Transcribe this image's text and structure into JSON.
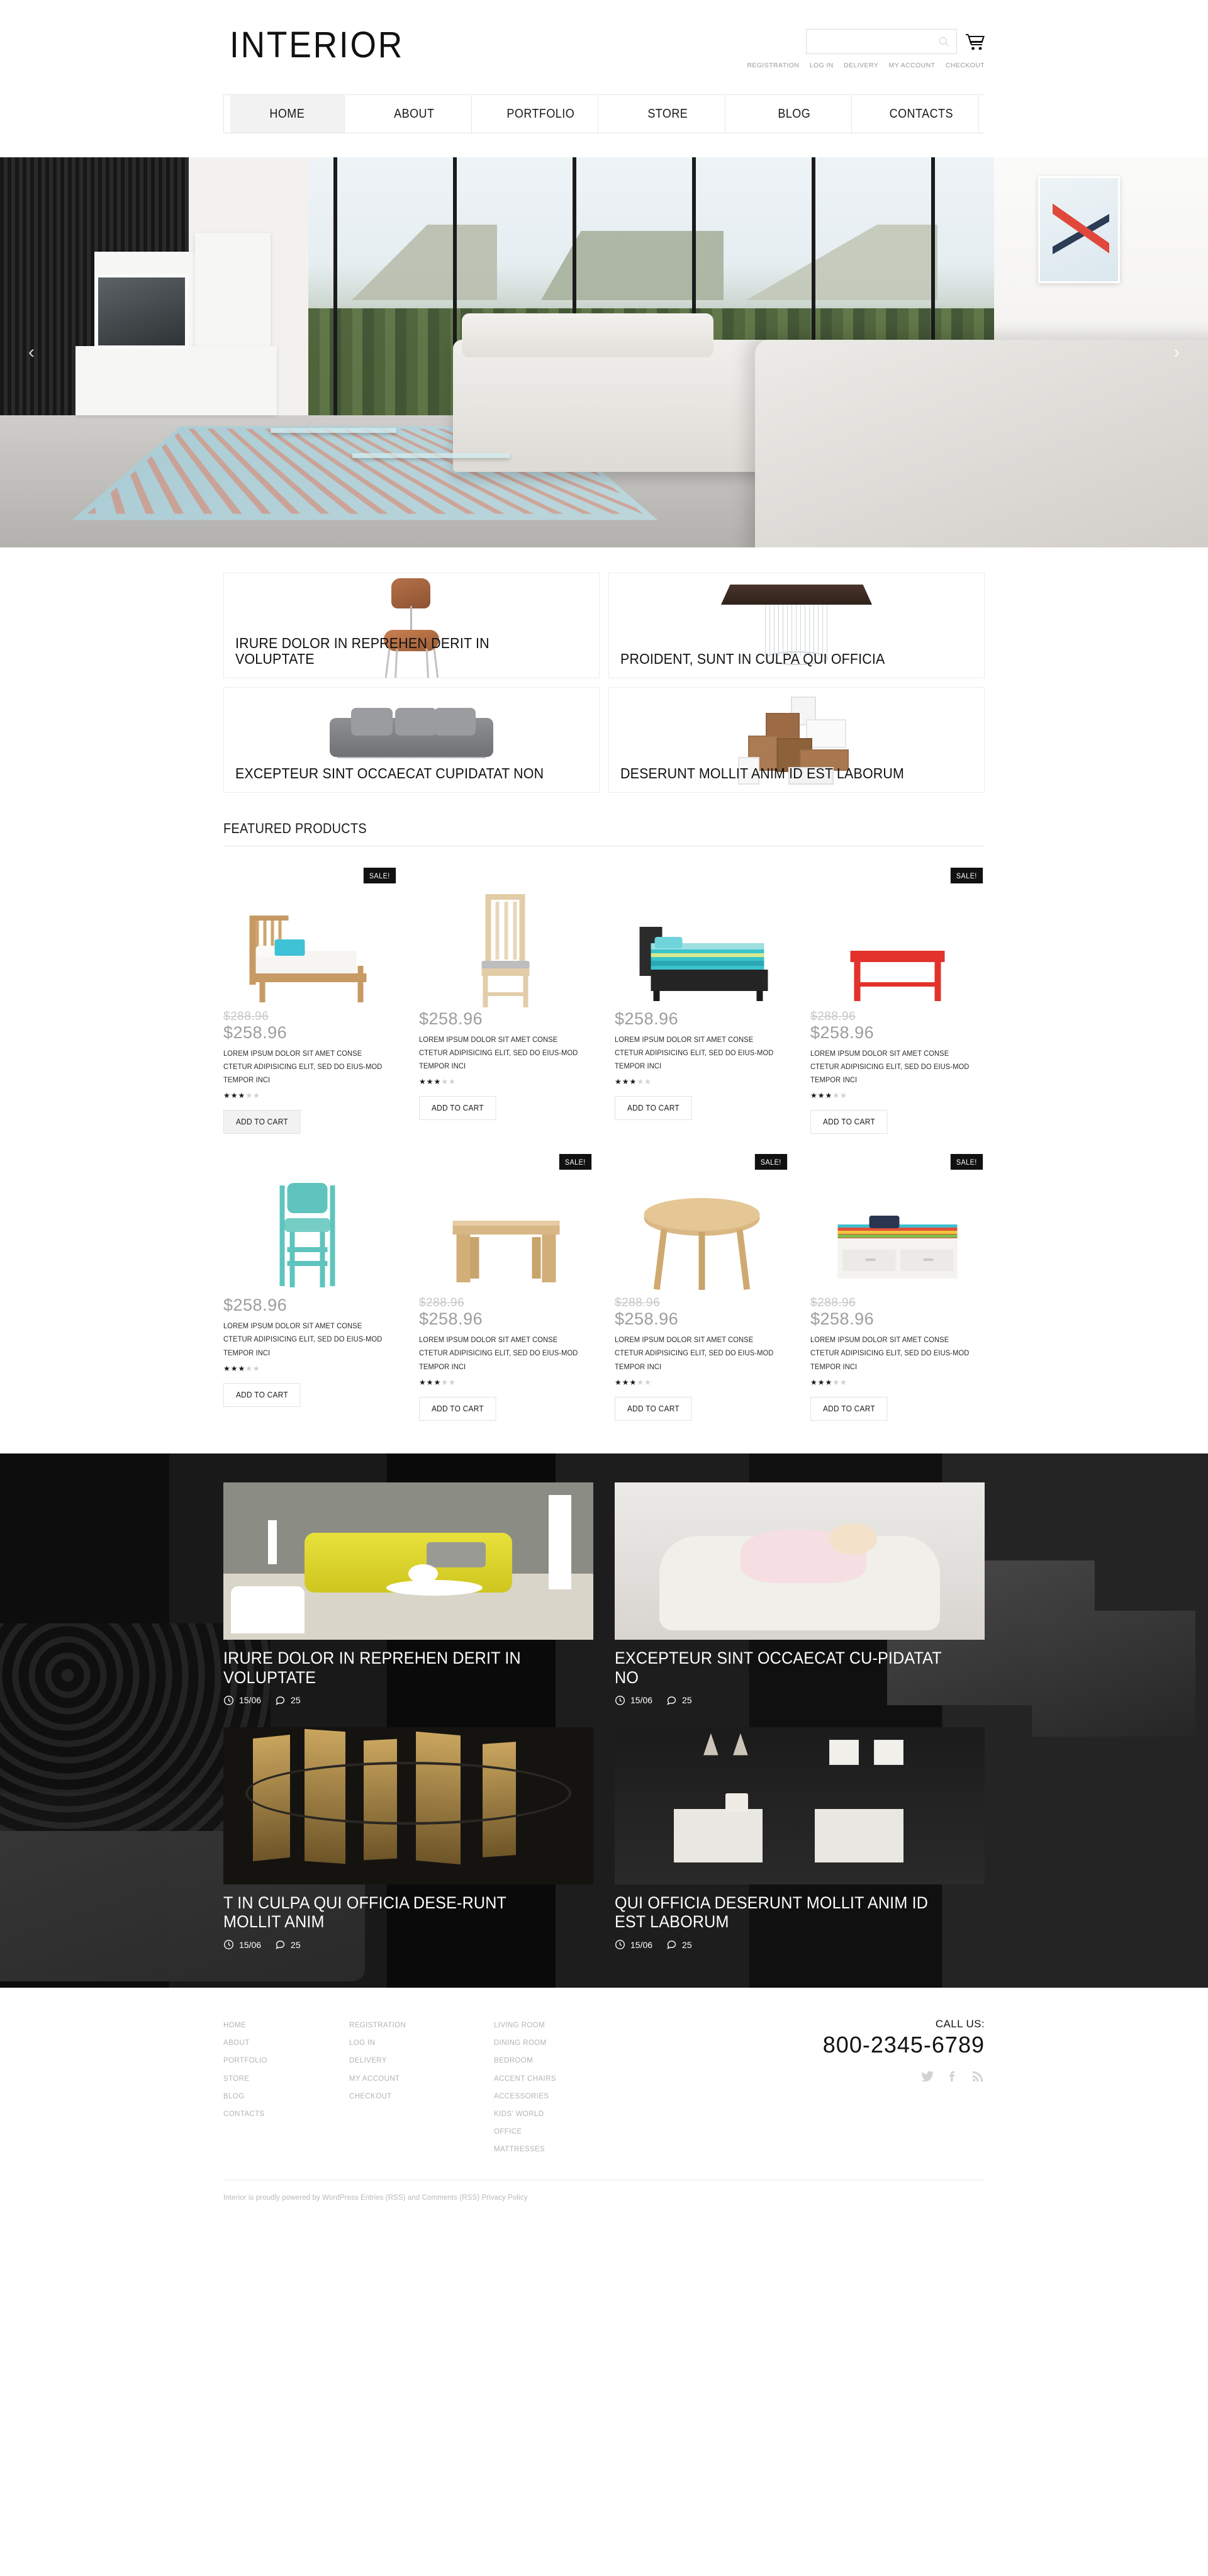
{
  "site": {
    "logo": "INTERIOR"
  },
  "search": {
    "value": "",
    "placeholder": "",
    "icon": "search-icon"
  },
  "cart": {
    "icon": "shopping-cart-icon"
  },
  "utility_links": [
    {
      "label": "REGISTRATION"
    },
    {
      "label": "LOG IN"
    },
    {
      "label": "DELIVERY"
    },
    {
      "label": "MY ACCOUNT"
    },
    {
      "label": "CHECKOUT"
    }
  ],
  "nav": [
    {
      "label": "HOME",
      "active": true
    },
    {
      "label": "ABOUT",
      "active": false
    },
    {
      "label": "PORTFOLIO",
      "active": false
    },
    {
      "label": "STORE",
      "active": false
    },
    {
      "label": "BLOG",
      "active": false
    },
    {
      "label": "CONTACTS",
      "active": false
    }
  ],
  "slider": {
    "prev_icon": "chevron-left-icon",
    "next_icon": "chevron-right-icon",
    "prev_label": "‹",
    "next_label": "›"
  },
  "categories": [
    {
      "title": "IRURE DOLOR IN REPREHEN DERIT IN VOLUPTATE",
      "art": "chair"
    },
    {
      "title": "PROIDENT, SUNT IN CULPA QUI OFFICIA",
      "art": "table"
    },
    {
      "title": "EXCEPTEUR SINT OCCAECAT CUPIDATAT NON",
      "art": "sofa"
    },
    {
      "title": "DESERUNT MOLLIT ANIM ID EST LABORUM",
      "art": "shelf"
    }
  ],
  "featured": {
    "title": "FEATURED PRODUCTS",
    "add_to_cart": "ADD TO CART",
    "sale_badge": "SALE!",
    "description": "LOREM IPSUM DOLOR SIT AMET CONSE CTETUR ADIPISICING ELIT, SED DO EIUS-MOD TEMPOR INCI",
    "products": [
      {
        "old_price": "$288.96",
        "price": "$258.96",
        "sale": true,
        "rating": 3,
        "art": "bed-wood",
        "cart_filled": true
      },
      {
        "old_price": "",
        "price": "$258.96",
        "sale": false,
        "rating": 3,
        "art": "chair-tall",
        "cart_filled": false
      },
      {
        "old_price": "",
        "price": "$258.96",
        "sale": false,
        "rating": 3,
        "art": "bed-dark",
        "cart_filled": false
      },
      {
        "old_price": "$288.96",
        "price": "$258.96",
        "sale": true,
        "rating": 3,
        "art": "bench-red",
        "cart_filled": false
      },
      {
        "old_price": "",
        "price": "$258.96",
        "sale": false,
        "rating": 3,
        "art": "chair-mint",
        "cart_filled": false
      },
      {
        "old_price": "$288.96",
        "price": "$258.96",
        "sale": true,
        "rating": 3,
        "art": "stool-wood",
        "cart_filled": false
      },
      {
        "old_price": "$288.96",
        "price": "$258.96",
        "sale": true,
        "rating": 3,
        "art": "table-round",
        "cart_filled": false
      },
      {
        "old_price": "$288.96",
        "price": "$258.96",
        "sale": true,
        "rating": 3,
        "art": "daybed",
        "cart_filled": false
      }
    ]
  },
  "blog": {
    "posts": [
      {
        "title": "IRURE DOLOR IN REPREHEN DERIT IN VOLUPTATE",
        "date": "15/06",
        "comments": "25",
        "art": "yellow"
      },
      {
        "title": "EXCEPTEUR SINT OCCAECAT CU-PIDATAT NO",
        "date": "15/06",
        "comments": "25",
        "art": "baby"
      },
      {
        "title": "T IN CULPA QUI OFFICIA DESE-RUNT MOLLIT ANIM",
        "date": "15/06",
        "comments": "25",
        "art": "gold"
      },
      {
        "title": "QUI OFFICIA DESERUNT MOLLIT ANIM ID EST LABORUM",
        "date": "15/06",
        "comments": "25",
        "art": "tables"
      }
    ],
    "date_icon": "clock-icon",
    "comment_icon": "comment-bubble-icon"
  },
  "footer": {
    "col1": [
      {
        "label": "HOME"
      },
      {
        "label": "ABOUT"
      },
      {
        "label": "PORTFOLIO"
      },
      {
        "label": "STORE"
      },
      {
        "label": "BLOG"
      },
      {
        "label": "CONTACTS"
      }
    ],
    "col2": [
      {
        "label": "REGISTRATION"
      },
      {
        "label": "LOG IN"
      },
      {
        "label": "DELIVERY"
      },
      {
        "label": "MY ACCOUNT"
      },
      {
        "label": "CHECKOUT"
      }
    ],
    "col3": [
      {
        "label": "LIVING ROOM"
      },
      {
        "label": "DINING ROOM"
      },
      {
        "label": "BEDROOM"
      },
      {
        "label": "ACCENT CHAIRS"
      },
      {
        "label": "ACCESSORIES"
      },
      {
        "label": "KIDS' WORLD"
      },
      {
        "label": "OFFICE"
      },
      {
        "label": "MATTRESSES"
      }
    ],
    "call_us": "CALL US:",
    "phone": "800-2345-6789",
    "socials": [
      {
        "name": "twitter-icon"
      },
      {
        "name": "facebook-icon"
      },
      {
        "name": "rss-icon"
      }
    ],
    "copyright": "Interior is proudly powered by WordPress Entries (RSS) and Comments (RSS) Privacy Policy"
  }
}
